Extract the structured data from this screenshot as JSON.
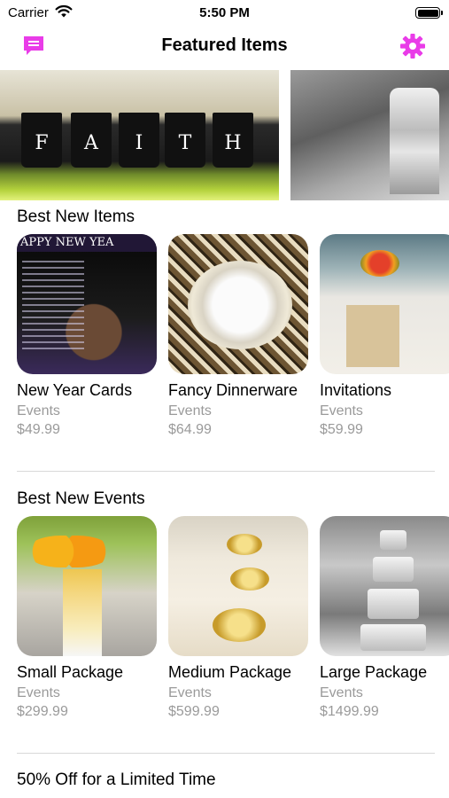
{
  "status_bar": {
    "carrier": "Carrier",
    "time": "5:50 PM"
  },
  "nav": {
    "title": "Featured Items",
    "accent_color": "#e93ce8"
  },
  "banner": {
    "slides": [
      {
        "letters": [
          "F",
          "A",
          "I",
          "T",
          "H"
        ]
      },
      {}
    ]
  },
  "sections": {
    "new_items": {
      "title": "Best New Items",
      "items": [
        {
          "name": "New Year Cards",
          "category": "Events",
          "price": "$49.99",
          "image_text": "APPY NEW YEA"
        },
        {
          "name": "Fancy Dinnerware",
          "category": "Events",
          "price": "$64.99"
        },
        {
          "name": "Invitations",
          "category": "Events",
          "price": "$59.99"
        }
      ]
    },
    "new_events": {
      "title": "Best New Events",
      "items": [
        {
          "name": "Small Package",
          "category": "Events",
          "price": "$299.99"
        },
        {
          "name": "Medium Package",
          "category": "Events",
          "price": "$599.99"
        },
        {
          "name": "Large Package",
          "category": "Events",
          "price": "$1499.99"
        }
      ]
    },
    "promo": {
      "title": "50% Off for a Limited Time"
    }
  },
  "icons": {
    "chat": "chat-bubble-icon",
    "settings": "gear-icon",
    "wifi": "wifi-icon",
    "battery": "battery-icon"
  }
}
